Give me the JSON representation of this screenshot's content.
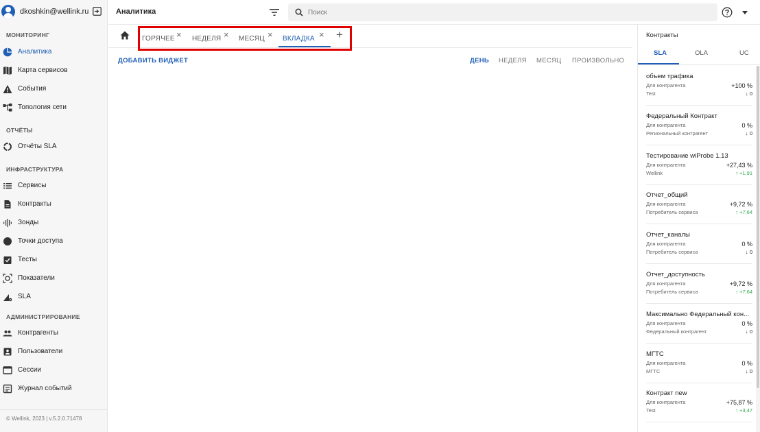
{
  "user": {
    "email": "dkoshkin@wellink.ru"
  },
  "header": {
    "title": "Аналитика",
    "search_placeholder": "Поиск"
  },
  "sidebar": {
    "sections": {
      "monitoring": "МОНИТОРИНГ",
      "reports": "ОТЧЁТЫ",
      "infrastructure": "ИНФРАСТРУКТУРА",
      "administration": "АДМИНИСТРИРОВАНИЕ"
    },
    "items": {
      "analytics": "Аналитика",
      "service_map": "Карта сервисов",
      "events": "События",
      "topology": "Топология сети",
      "sla_reports": "Отчёты SLA",
      "services": "Сервисы",
      "contracts": "Контракты",
      "probes": "Зонды",
      "access_points": "Точки доступа",
      "tests": "Тесты",
      "indicators": "Показатели",
      "sla": "SLA",
      "counterparties": "Контрагенты",
      "users": "Пользователи",
      "sessions": "Сессии",
      "event_log": "Журнал событий"
    },
    "footer": "© Wellink, 2023 | v.5.2.0.71478"
  },
  "tabs": [
    {
      "label": "ГОРЯЧЕЕ",
      "active": false
    },
    {
      "label": "НЕДЕЛЯ",
      "active": false
    },
    {
      "label": "МЕСЯЦ",
      "active": false
    },
    {
      "label": "ВКЛАДКА",
      "active": true
    }
  ],
  "toolbar": {
    "add_widget": "ДОБАВИТЬ ВИДЖЕТ",
    "periods": [
      "ДЕНЬ",
      "НЕДЕЛЯ",
      "МЕСЯЦ",
      "ПРОИЗВОЛЬНО"
    ],
    "active_period": "ДЕНЬ"
  },
  "contracts_panel": {
    "title": "Контракты",
    "tabs": [
      "SLA",
      "OLA",
      "UC"
    ],
    "active_tab": "SLA",
    "items": [
      {
        "name": "объем трафика",
        "label1": "Для контрагента",
        "value1": "+100 %",
        "label2": "Test",
        "value2": "↓ 0",
        "trend": "down"
      },
      {
        "name": "Федеральный Контракт",
        "label1": "Для контрагента",
        "value1": "0 %",
        "label2": "Региональный контрагент",
        "value2": "↓ 0",
        "trend": "down"
      },
      {
        "name": "Тестирование wiProbe 1.13",
        "label1": "Для контрагента",
        "value1": "+27,43 %",
        "label2": "Wellink",
        "value2": "↑ +1,91",
        "trend": "up"
      },
      {
        "name": "Отчет_общий",
        "label1": "Для контрагента",
        "value1": "+9,72 %",
        "label2": "Потребитель сервиса",
        "value2": "↑ +7,64",
        "trend": "up"
      },
      {
        "name": "Отчет_каналы",
        "label1": "Для контрагента",
        "value1": "0 %",
        "label2": "Потребитель сервиса",
        "value2": "↓ 0",
        "trend": "down"
      },
      {
        "name": "Отчет_доступность",
        "label1": "Для контрагента",
        "value1": "+9,72 %",
        "label2": "Потребитель сервиса",
        "value2": "↑ +7,64",
        "trend": "up"
      },
      {
        "name": "Максимально Федеральный кон...",
        "label1": "Для контрагента",
        "value1": "0 %",
        "label2": "Федеральный контрагент",
        "value2": "↓ 0",
        "trend": "down"
      },
      {
        "name": "МГТС",
        "label1": "Для контрагента",
        "value1": "0 %",
        "label2": "МГТС",
        "value2": "↓ 0",
        "trend": "down"
      },
      {
        "name": "Контракт new",
        "label1": "Для контрагента",
        "value1": "+75,87 %",
        "label2": "Test",
        "value2": "↑ +3,47",
        "trend": "up"
      }
    ]
  },
  "colors": {
    "accent": "#1f5fb4",
    "up": "#2da84a",
    "highlight": "#e00000"
  }
}
